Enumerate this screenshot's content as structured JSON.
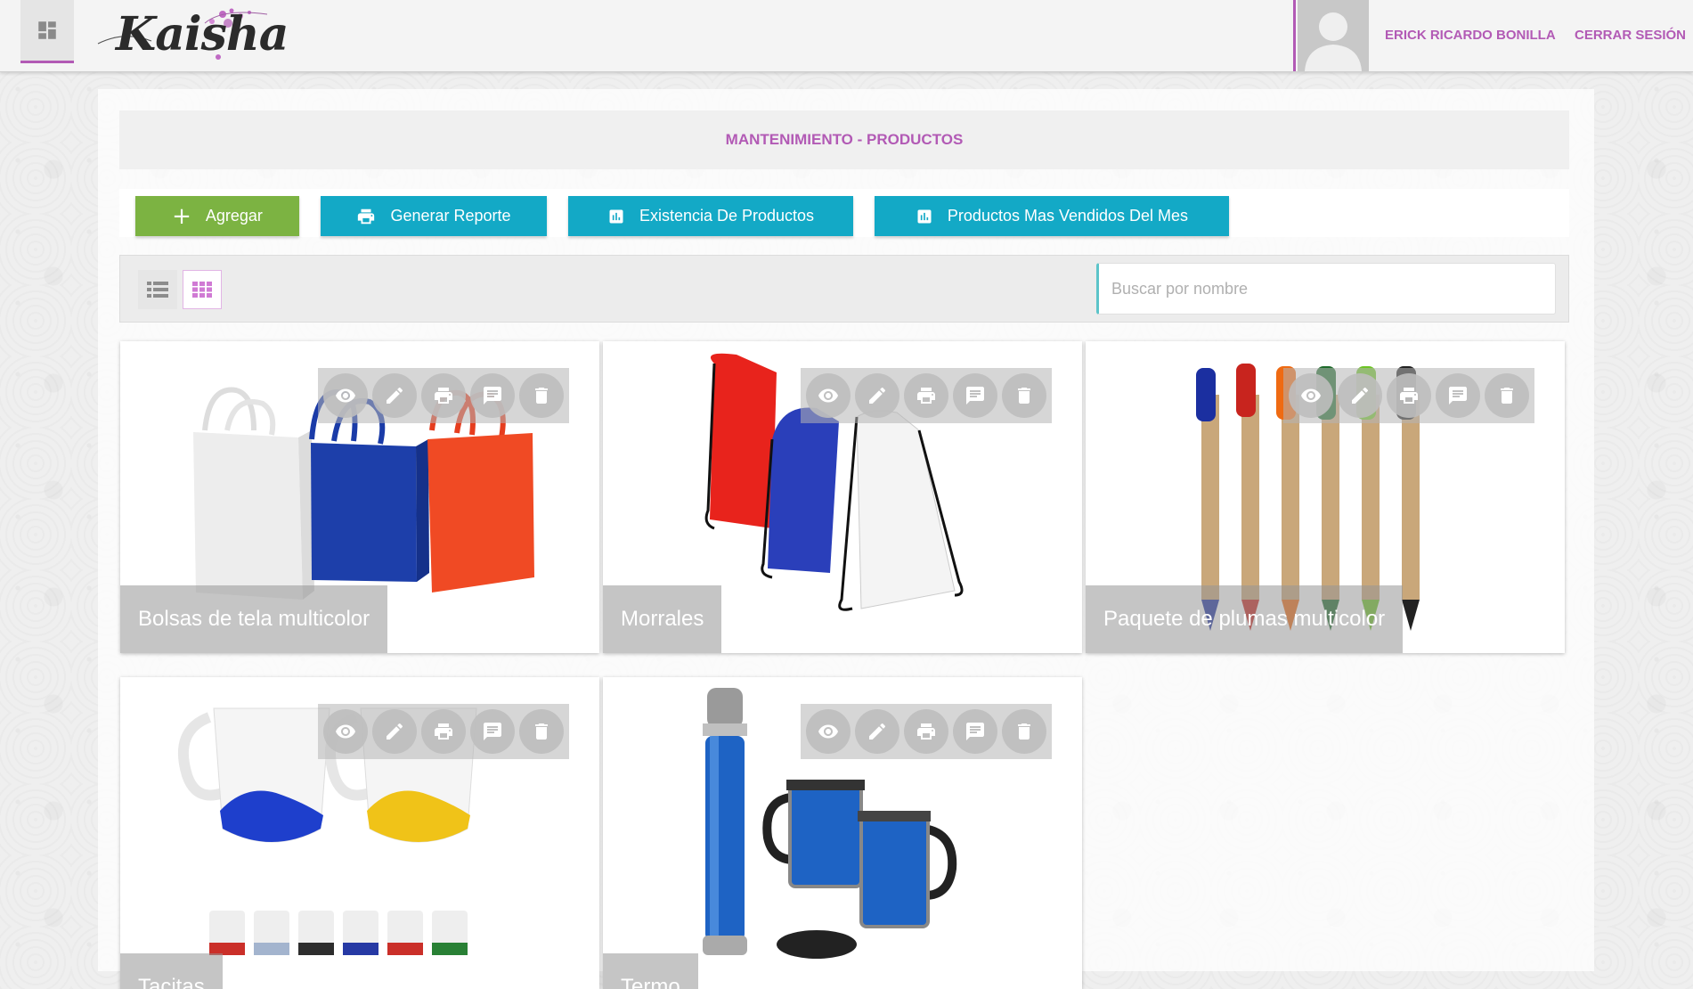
{
  "header": {
    "brand": "Kaisha",
    "user_name": "ERICK RICARDO BONILLA",
    "logout_label": "CERRAR SESIÓN"
  },
  "page": {
    "title": "MANTENIMIENTO - PRODUCTOS"
  },
  "toolbar": {
    "add_label": "Agregar",
    "report_label": "Generar Reporte",
    "stock_label": "Existencia De Productos",
    "top_sellers_label": "Productos Mas Vendidos Del Mes"
  },
  "filter": {
    "search_placeholder": "Buscar por nombre",
    "view_mode": "grid"
  },
  "products": [
    {
      "name": "Bolsas de tela multicolor"
    },
    {
      "name": "Morrales"
    },
    {
      "name": "Paquete de plumas multicolor"
    },
    {
      "name": "Tacitas"
    },
    {
      "name": "Termo"
    }
  ],
  "card_actions": [
    "view-icon",
    "edit-icon",
    "print-icon",
    "comment-icon",
    "delete-icon"
  ],
  "colors": {
    "accent": "#b25ab5",
    "add_button": "#7cb342",
    "action_button": "#13a9c6"
  }
}
